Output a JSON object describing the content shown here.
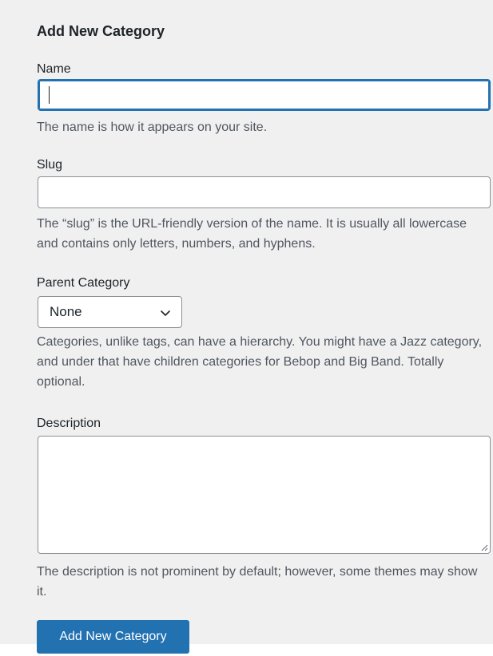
{
  "form": {
    "heading": "Add New Category",
    "name": {
      "label": "Name",
      "value": "",
      "help": "The name is how it appears on your site."
    },
    "slug": {
      "label": "Slug",
      "value": "",
      "help": "The “slug” is the URL-friendly version of the name. It is usually all lowercase and contains only letters, numbers, and hyphens."
    },
    "parent": {
      "label": "Parent Category",
      "selected": "None",
      "help": "Categories, unlike tags, can have a hierarchy. You might have a Jazz category, and under that have children categories for Bebop and Big Band. Totally optional."
    },
    "description": {
      "label": "Description",
      "value": "",
      "help": "The description is not prominent by default; however, some themes may show it."
    },
    "submit_label": "Add New Category"
  },
  "icons": {
    "select": "chevron-down-icon",
    "textarea_resize": "resize-grip-icon"
  },
  "colors": {
    "panel_background": "#f0f0f1",
    "primary_button": "#2271b1",
    "focus_border": "#2271b1",
    "input_border": "#8c8f94",
    "help_text": "#50575e"
  }
}
